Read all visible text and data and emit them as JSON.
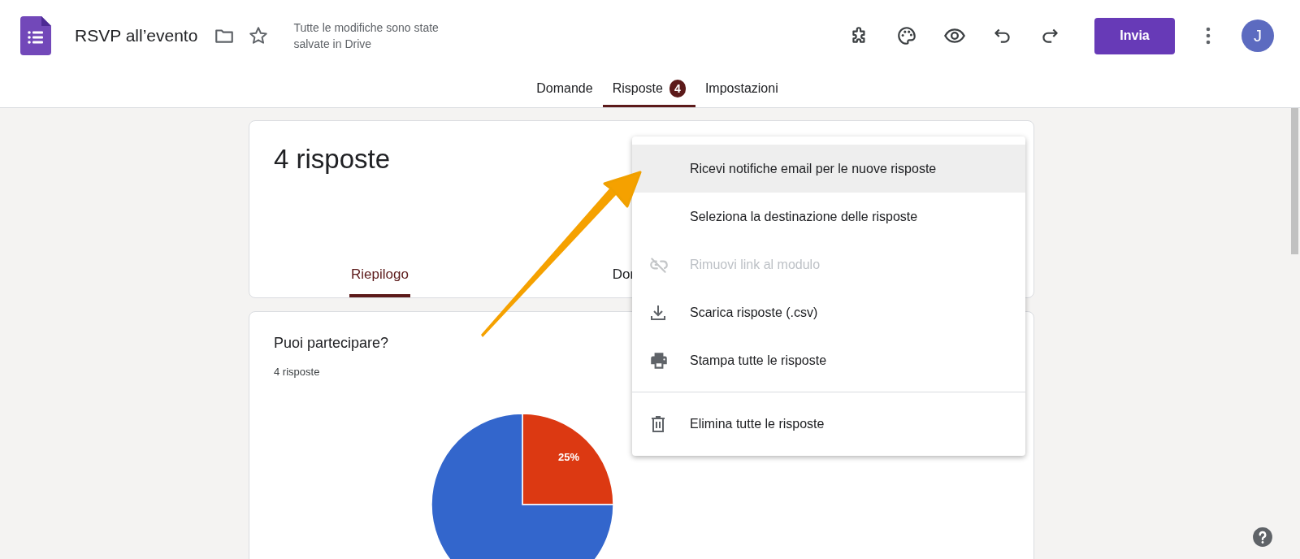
{
  "header": {
    "title": "RSVP all’evento",
    "save_status": "Tutte le modifiche sono state salvate in Drive",
    "send_button": "Invia",
    "avatar": "J"
  },
  "tabs": [
    {
      "label": "Domande",
      "selected": false
    },
    {
      "label": "Risposte",
      "selected": true,
      "badge": "4"
    },
    {
      "label": "Impostazioni",
      "selected": false
    }
  ],
  "summary_card": {
    "title": "4 risposte",
    "tabs": [
      {
        "label": "Riepilogo",
        "selected": true
      },
      {
        "label": "Dor",
        "selected": false
      }
    ]
  },
  "question_card": {
    "title": "Puoi partecipare?",
    "count": "4 risposte",
    "chart_data": {
      "type": "pie",
      "values": [
        25,
        75
      ],
      "value_labels": [
        "25%",
        null
      ]
    }
  },
  "menu": {
    "items": [
      {
        "label": "Ricevi notifiche email per le nuove risposte",
        "selected": true,
        "disabled": false,
        "divider_before": false
      },
      {
        "label": "Seleziona la destinazione delle risposte",
        "selected": false,
        "disabled": false,
        "divider_before": false
      },
      {
        "label": "Rimuovi link al modulo",
        "selected": false,
        "disabled": true,
        "divider_before": false
      },
      {
        "label": "Scarica risposte (.csv)",
        "selected": false,
        "disabled": false,
        "divider_before": false
      },
      {
        "label": "Stampa tutte le risposte",
        "selected": false,
        "disabled": false,
        "divider_before": false
      },
      {
        "label": "Elimina tutte le risposte",
        "selected": false,
        "disabled": false,
        "divider_before": true
      }
    ]
  }
}
